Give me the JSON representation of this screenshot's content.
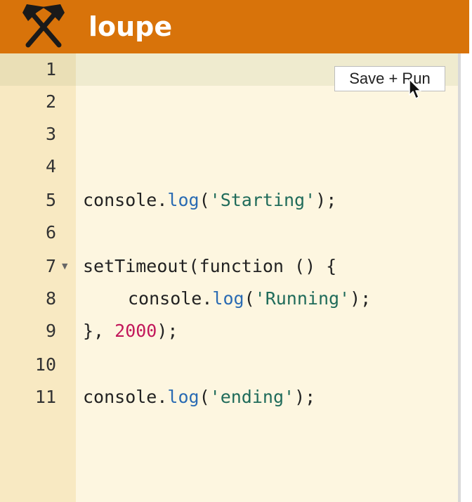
{
  "app": {
    "title": "loupe",
    "colors": {
      "header": "#d8730a",
      "editor_bg": "#fdf6e0",
      "gutter_bg": "#f8e9c2",
      "method": "#2a6bb3",
      "string": "#1f6b5a",
      "number": "#c2185b"
    },
    "icons": {
      "logo": "crossed-hammers-icon",
      "cursor": "mouse-pointer-icon"
    }
  },
  "toolbar": {
    "save_run_label": "Save + Run"
  },
  "editor": {
    "active_line": 1,
    "lines": [
      {
        "number": "1"
      },
      {
        "number": "2"
      },
      {
        "number": "3"
      },
      {
        "number": "4"
      },
      {
        "number": "5",
        "parts": {
          "p1": "console.",
          "p2": "log",
          "p3": "(",
          "p4": "'Starting'",
          "p5": ");"
        }
      },
      {
        "number": "6"
      },
      {
        "number": "7",
        "text": "setTimeout(function () {"
      },
      {
        "number": "8",
        "parts": {
          "p1": "console.",
          "p2": "log",
          "p3": "(",
          "p4": "'Running'",
          "p5": ");"
        }
      },
      {
        "number": "9",
        "parts": {
          "p1": "}, ",
          "p2": "2000",
          "p3": ");"
        }
      },
      {
        "number": "10"
      },
      {
        "number": "11",
        "parts": {
          "p1": "console.",
          "p2": "log",
          "p3": "(",
          "p4": "'ending'",
          "p5": ");"
        }
      }
    ]
  }
}
